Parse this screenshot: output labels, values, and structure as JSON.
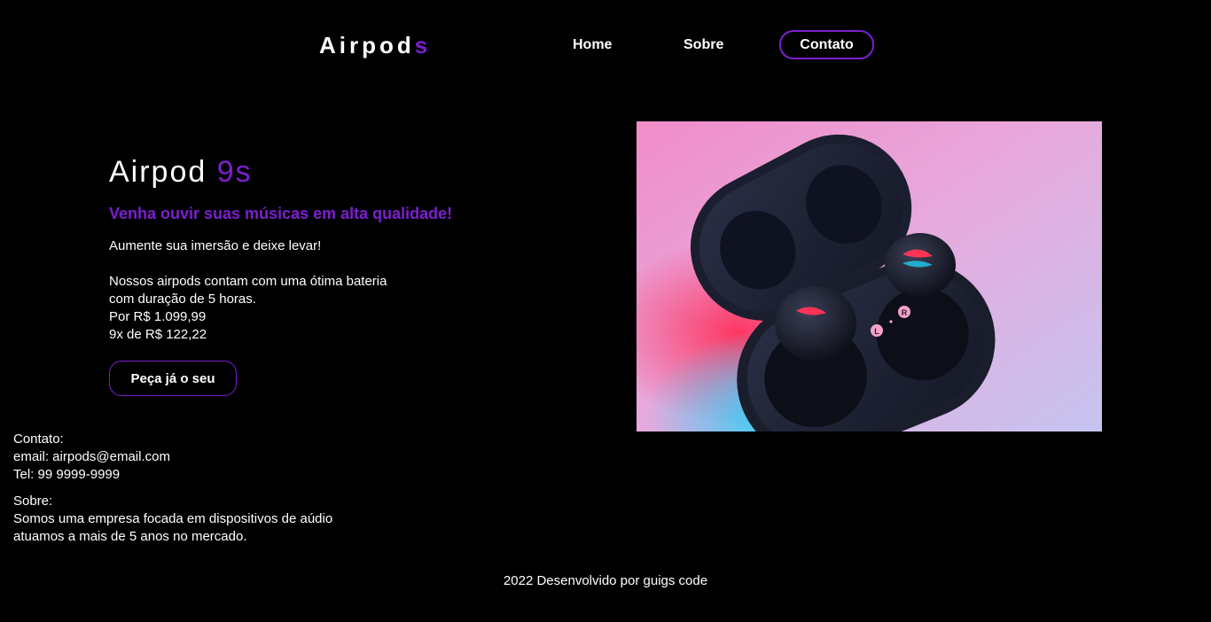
{
  "header": {
    "logo_main": "Airpod",
    "logo_accent": "s",
    "nav": {
      "home": "Home",
      "sobre": "Sobre",
      "contato": "Contato"
    }
  },
  "hero": {
    "title_main": "Airpod",
    "title_accent": "9s",
    "subtitle": "Venha ouvir suas músicas em alta qualidade!",
    "intro": "Aumente sua imersão e deixe levar!",
    "battery_line1": "Nossos airpods contam com uma ótima bateria",
    "battery_line2": "com duração de 5 horas.",
    "price": "Por R$ 1.099,99",
    "installments": "9x de R$ 122,22",
    "cta_label": "Peça já o seu"
  },
  "product_image": {
    "alt": "Estojo de fones de ouvido sem fio com iluminação rosa e azul",
    "case_letters": [
      "L",
      "R"
    ]
  },
  "contact": {
    "heading": "Contato:",
    "email": "email: airpods@email.com",
    "phone": "Tel: 99 9999-9999"
  },
  "about": {
    "heading": "Sobre:",
    "line1": "Somos uma empresa focada em dispositivos de aúdio",
    "line2": "atuamos a mais de 5 anos no mercado."
  },
  "footer": {
    "text": "2022 Desenvolvido por guigs code"
  },
  "colors": {
    "background": "#000000",
    "accent": "#7b1fcf",
    "text": "#ffffff"
  }
}
